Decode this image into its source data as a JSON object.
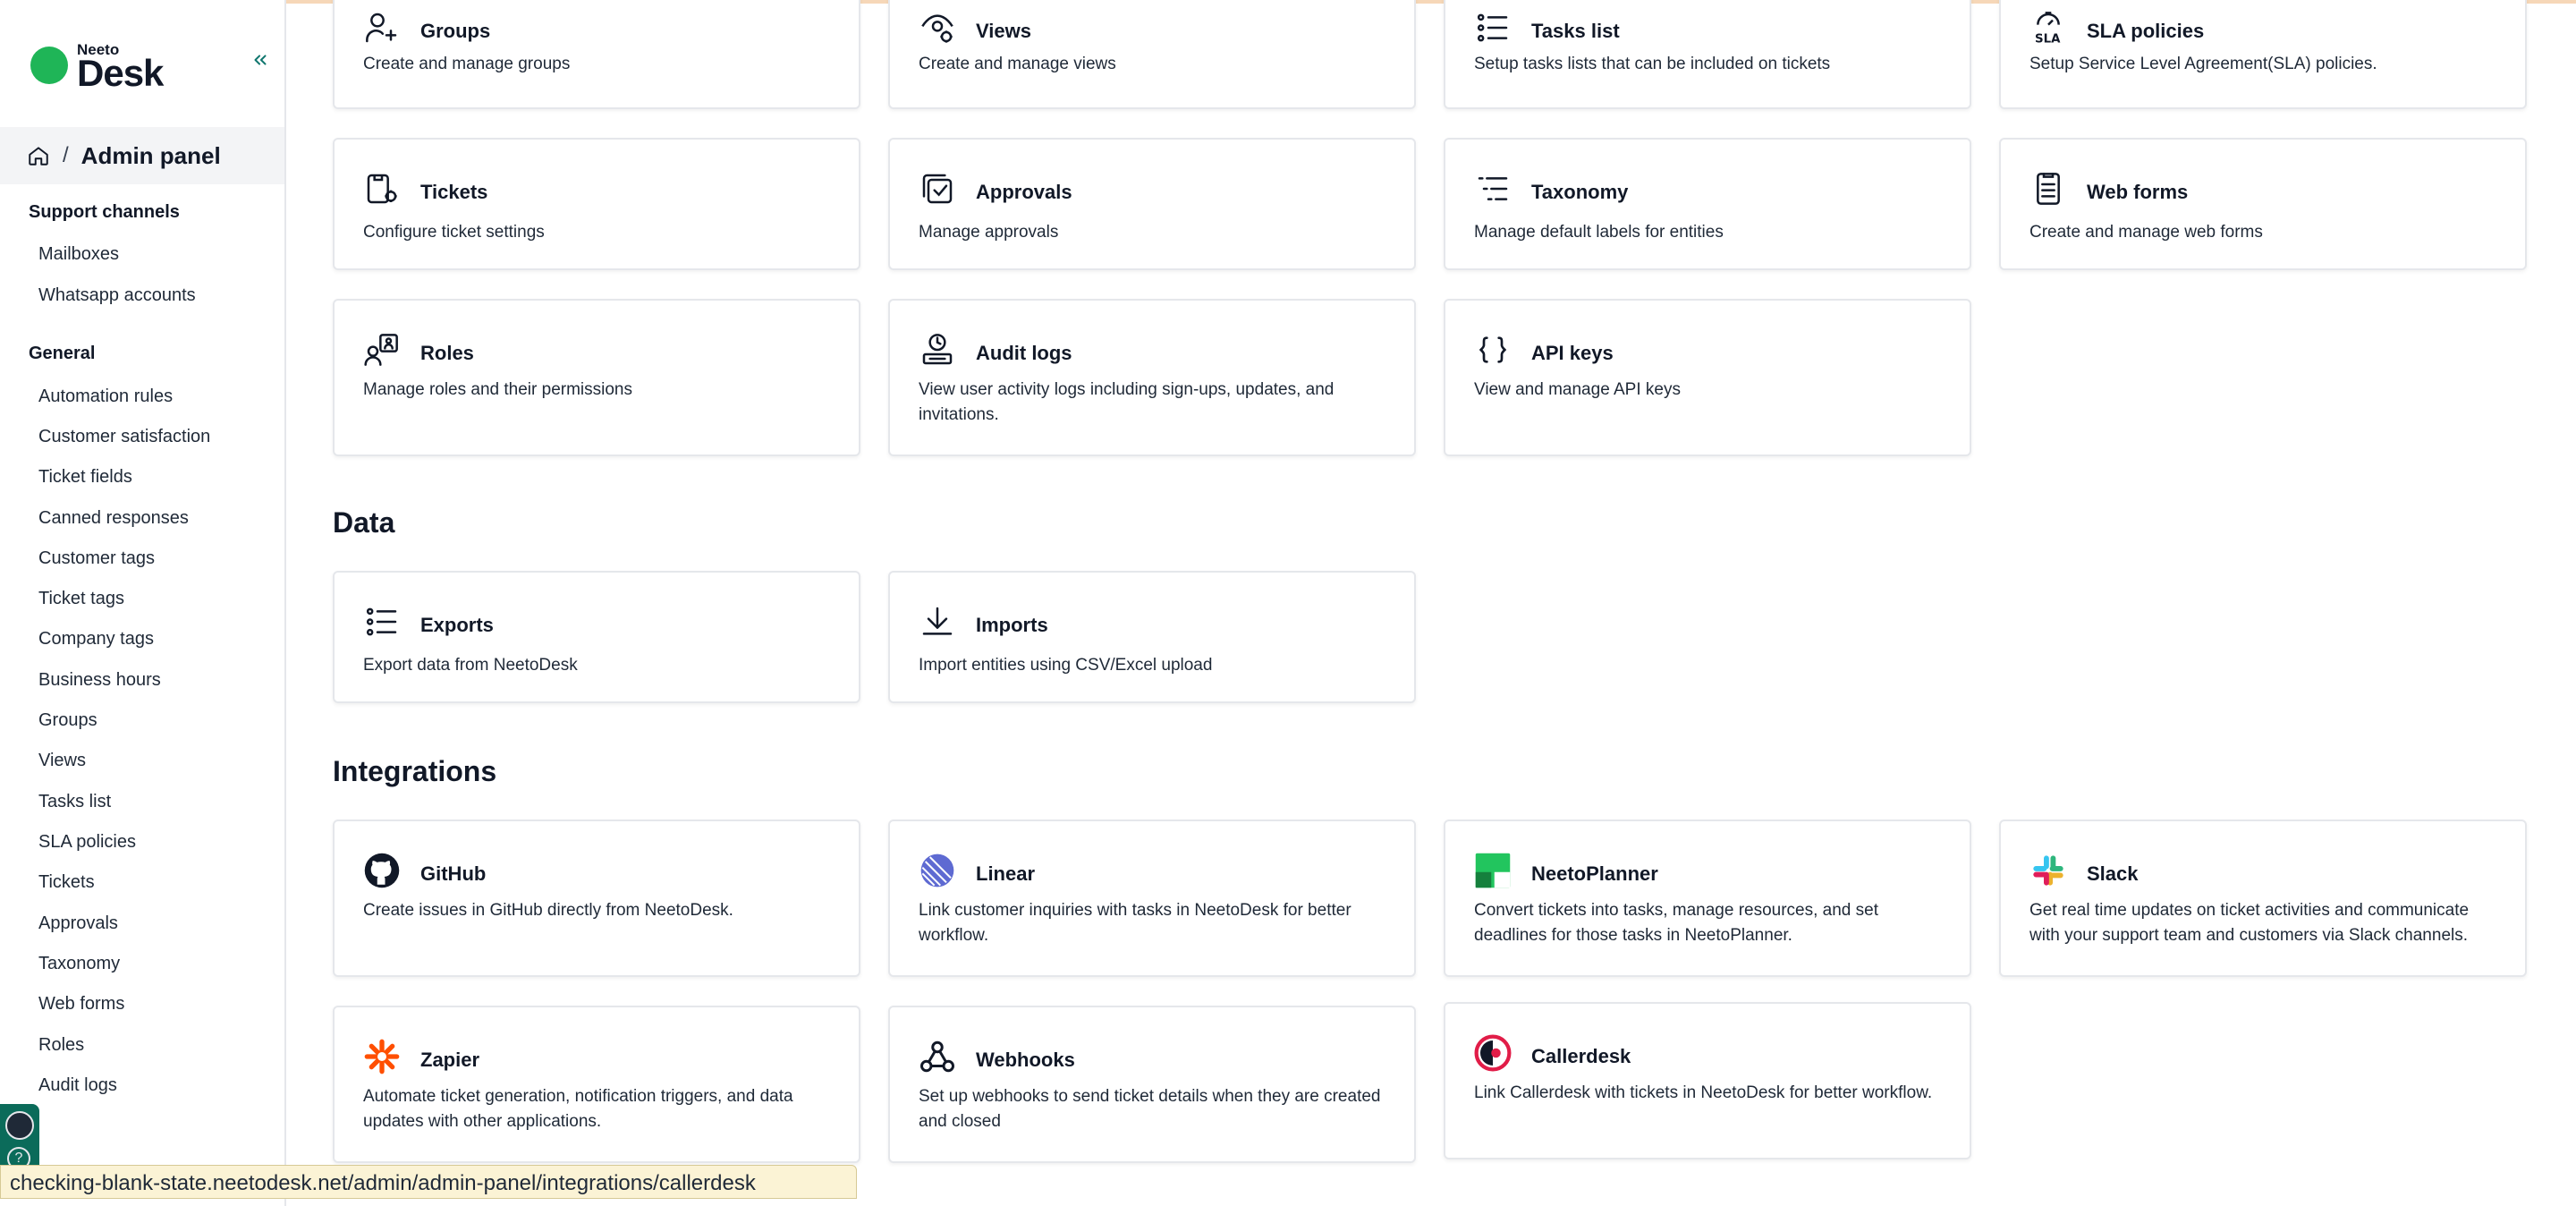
{
  "brand": {
    "small": "Neeto",
    "big": "Desk"
  },
  "breadcrumb": {
    "separator": "/",
    "current": "Admin panel"
  },
  "sidebar": {
    "sections": [
      {
        "title": "Support channels",
        "items": [
          "Mailboxes",
          "Whatsapp accounts"
        ]
      },
      {
        "title": "General",
        "items": [
          "Automation rules",
          "Customer satisfaction",
          "Ticket fields",
          "Canned responses",
          "Customer tags",
          "Ticket tags",
          "Company tags",
          "Business hours",
          "Groups",
          "Views",
          "Tasks list",
          "SLA policies",
          "Tickets",
          "Approvals",
          "Taxonomy",
          "Web forms",
          "Roles",
          "Audit logs"
        ]
      }
    ]
  },
  "general_cards": [
    {
      "title": "Groups",
      "desc": "Create and manage groups",
      "icon": "user-plus-icon"
    },
    {
      "title": "Views",
      "desc": "Create and manage views",
      "icon": "eye-settings-icon"
    },
    {
      "title": "Tasks list",
      "desc": "Setup tasks lists that can be included on tickets",
      "icon": "list-icon"
    },
    {
      "title": "SLA policies",
      "desc": "Setup Service Level Agreement(SLA) policies.",
      "icon": "sla-timer-icon"
    },
    {
      "title": "Tickets",
      "desc": "Configure ticket settings",
      "icon": "ticket-settings-icon"
    },
    {
      "title": "Approvals",
      "desc": "Manage approvals",
      "icon": "approval-check-icon"
    },
    {
      "title": "Taxonomy",
      "desc": "Manage default labels for entities",
      "icon": "taxonomy-icon"
    },
    {
      "title": "Web forms",
      "desc": "Create and manage web forms",
      "icon": "document-icon"
    },
    {
      "title": "Roles",
      "desc": "Manage roles and their permissions",
      "icon": "roles-icon"
    },
    {
      "title": "Audit logs",
      "desc": "View user activity logs including sign-ups, updates, and invitations.",
      "icon": "audit-log-icon"
    },
    {
      "title": "API keys",
      "desc": "View and manage API keys",
      "icon": "braces-icon"
    }
  ],
  "data_section": {
    "title": "Data",
    "cards": [
      {
        "title": "Exports",
        "desc": "Export data from NeetoDesk",
        "icon": "list-icon"
      },
      {
        "title": "Imports",
        "desc": "Import entities using CSV/Excel upload",
        "icon": "download-icon"
      }
    ]
  },
  "integrations_section": {
    "title": "Integrations",
    "cards": [
      {
        "title": "GitHub",
        "desc": "Create issues in GitHub directly from NeetoDesk.",
        "icon": "github-icon"
      },
      {
        "title": "Linear",
        "desc": "Link customer inquiries with tasks in NeetoDesk for better workflow.",
        "icon": "linear-icon"
      },
      {
        "title": "NeetoPlanner",
        "desc": "Convert tickets into tasks, manage resources, and set deadlines for those tasks in NeetoPlanner.",
        "icon": "neetoplanner-icon"
      },
      {
        "title": "Slack",
        "desc": "Get real time updates on ticket activities and communicate with your support team and customers via Slack channels.",
        "icon": "slack-icon"
      },
      {
        "title": "Zapier",
        "desc": "Automate ticket generation, notification triggers, and data updates with other applications.",
        "icon": "zapier-icon"
      },
      {
        "title": "Webhooks",
        "desc": "Set up webhooks to send ticket details when they are created and closed",
        "icon": "webhook-icon"
      },
      {
        "title": "Callerdesk",
        "desc": "Link Callerdesk with tickets in NeetoDesk for better workflow.",
        "icon": "callerdesk-icon"
      }
    ]
  },
  "status_bar": {
    "url": "checking-blank-state.neetodesk.net/admin/admin-panel/integrations/callerdesk"
  },
  "colors": {
    "brand_green": "#1fb557",
    "accent_teal": "#0f766e",
    "border": "#e5e7eb"
  }
}
